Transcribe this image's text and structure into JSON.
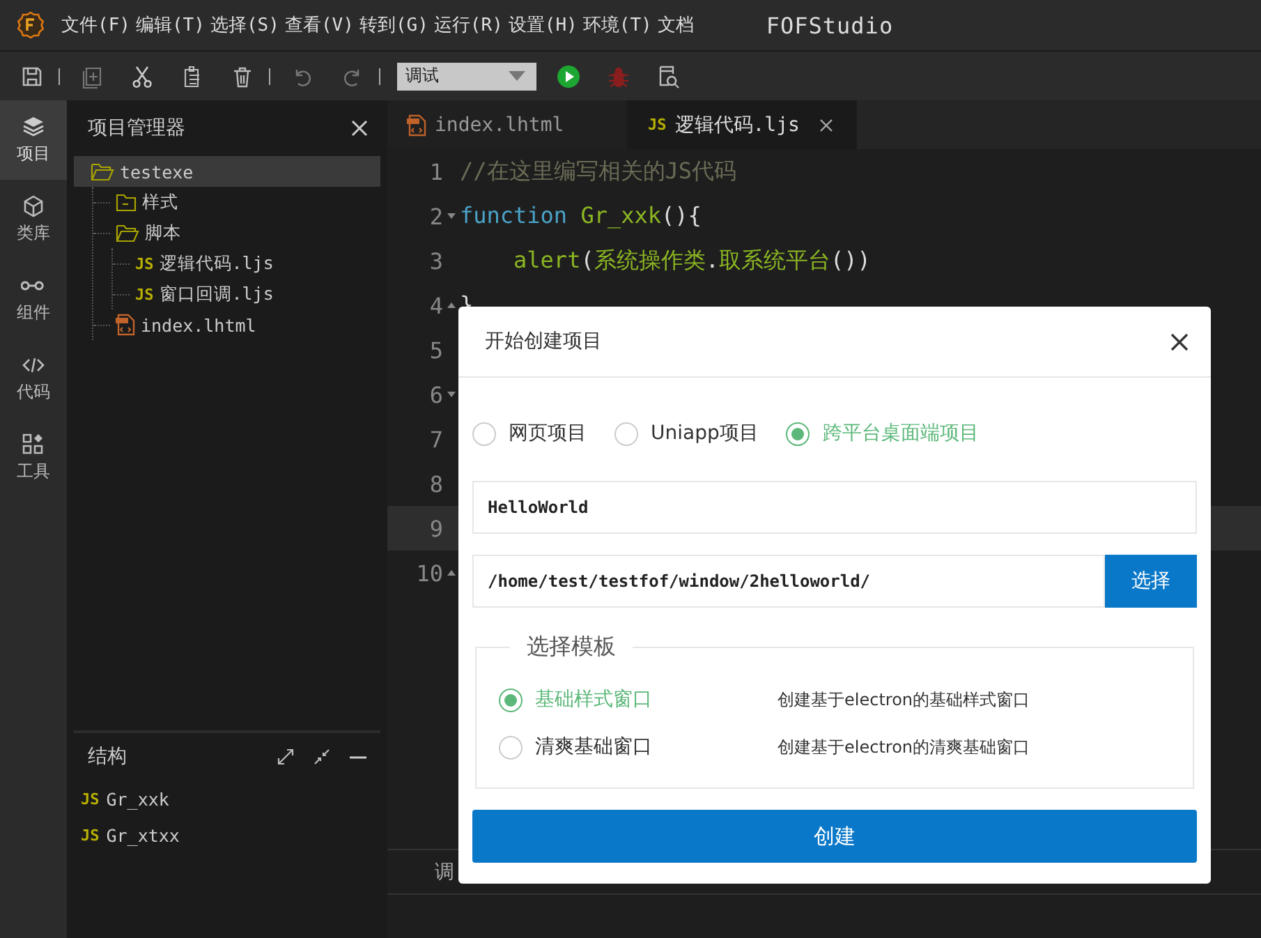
{
  "title_bar": {
    "menu": [
      "文件(F)",
      "编辑(T)",
      "选择(S)",
      "查看(V)",
      "转到(G)",
      "运行(R)",
      "设置(H)",
      "环境(T)",
      "文档"
    ],
    "app_title": "FOFStudio"
  },
  "toolbar": {
    "mode_select": {
      "value": "调试"
    }
  },
  "activity_bar": [
    {
      "label": "项目",
      "selected": true
    },
    {
      "label": "类库",
      "selected": false
    },
    {
      "label": "组件",
      "selected": false
    },
    {
      "label": "代码",
      "selected": false
    },
    {
      "label": "工具",
      "selected": false
    }
  ],
  "explorer": {
    "title": "项目管理器",
    "tree": [
      {
        "name": "testexe",
        "kind": "folder",
        "expanded": true,
        "selected": true,
        "children": [
          {
            "name": "样式",
            "kind": "folder",
            "expanded": false,
            "selected": false
          },
          {
            "name": "脚本",
            "kind": "folder",
            "expanded": true,
            "selected": false,
            "children": [
              {
                "name": "逻辑代码.ljs",
                "kind": "js",
                "badge": "JS",
                "selected": false
              },
              {
                "name": "窗口回调.ljs",
                "kind": "js",
                "badge": "JS",
                "selected": false
              }
            ]
          },
          {
            "name": "index.lhtml",
            "kind": "html",
            "selected": false
          }
        ]
      }
    ]
  },
  "structure": {
    "title": "结构",
    "items": [
      {
        "name": "Gr_xxk",
        "kind": "js",
        "badge": "JS"
      },
      {
        "name": "Gr_xtxx",
        "kind": "js",
        "badge": "JS"
      }
    ]
  },
  "editor": {
    "tabs": [
      {
        "label": "index.lhtml",
        "kind": "html",
        "selected": false
      },
      {
        "label": "逻辑代码.ljs",
        "kind": "js",
        "badge": "JS",
        "selected": true
      }
    ],
    "lines": [
      {
        "number": "1",
        "fold_start": false,
        "fold_end": false,
        "highlighted": false,
        "tokens": [
          {
            "kind": "comment",
            "text": "//在这里编写相关的JS代码"
          }
        ]
      },
      {
        "number": "2",
        "fold_start": true,
        "fold_end": false,
        "highlighted": false,
        "tokens": [
          {
            "kind": "keyword",
            "text": "function "
          },
          {
            "kind": "name",
            "text": "Gr_xxk"
          },
          {
            "kind": "plain",
            "text": "(){"
          }
        ]
      },
      {
        "number": "3",
        "fold_start": false,
        "fold_end": false,
        "highlighted": false,
        "tokens": [
          {
            "kind": "name",
            "text": "    alert"
          },
          {
            "kind": "plain",
            "text": "("
          },
          {
            "kind": "name",
            "text": "系统操作类"
          },
          {
            "kind": "plain",
            "text": "."
          },
          {
            "kind": "name",
            "text": "取系统平台"
          },
          {
            "kind": "plain",
            "text": "())"
          }
        ]
      },
      {
        "number": "4",
        "fold_start": false,
        "fold_end": true,
        "highlighted": false,
        "tokens": [
          {
            "kind": "plain",
            "text": "}"
          }
        ]
      },
      {
        "number": "5",
        "fold_start": false,
        "fold_end": false,
        "highlighted": false
      },
      {
        "number": "6",
        "fold_start": true,
        "fold_end": false,
        "highlighted": false
      },
      {
        "number": "7",
        "fold_start": false,
        "fold_end": false,
        "highlighted": false
      },
      {
        "number": "8",
        "fold_start": false,
        "fold_end": false,
        "highlighted": false
      },
      {
        "number": "9",
        "fold_start": false,
        "fold_end": false,
        "highlighted": true
      },
      {
        "number": "10",
        "fold_start": false,
        "fold_end": true,
        "highlighted": false
      }
    ],
    "bottom_panel": {
      "tabs": [
        {
          "label": "调"
        }
      ]
    }
  },
  "dialog": {
    "title": "开始创建项目",
    "project_types": [
      {
        "label": "网页项目",
        "selected": false
      },
      {
        "label": "Uniapp项目",
        "selected": false
      },
      {
        "label": "跨平台桌面端项目",
        "selected": true
      }
    ],
    "name_field": {
      "value": "HelloWorld"
    },
    "path_field": {
      "value": "/home/test/testfof/window/2helloworld/"
    },
    "choose_button": "选择",
    "template_group": {
      "legend": "选择模板",
      "options": [
        {
          "label": "基础样式窗口",
          "description": "创建基于electron的基础样式窗口",
          "selected": true
        },
        {
          "label": "清爽基础窗口",
          "description": "创建基于electron的清爽基础窗口",
          "selected": false
        }
      ]
    },
    "create_button": "创建"
  }
}
